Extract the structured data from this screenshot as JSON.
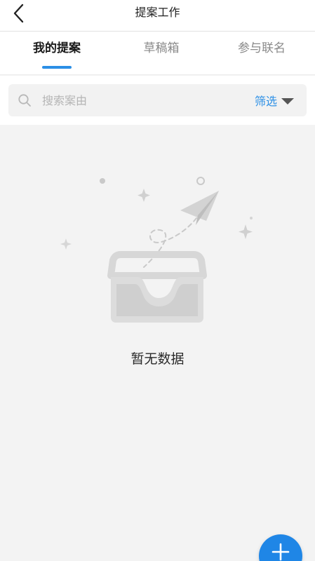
{
  "header": {
    "title": "提案工作"
  },
  "tabs": [
    {
      "label": "我的提案",
      "active": true
    },
    {
      "label": "草稿箱",
      "active": false
    },
    {
      "label": "参与联名",
      "active": false
    }
  ],
  "search": {
    "placeholder": "搜索案由",
    "value": "",
    "filter_label": "筛选"
  },
  "empty_state": {
    "message": "暂无数据"
  },
  "colors": {
    "accent": "#2b8fe6",
    "fab": "#1f86e6",
    "background": "#f3f3f3"
  },
  "icons": {
    "back": "chevron-left-icon",
    "search": "search-icon",
    "filter": "caret-down-icon",
    "fab": "plus-icon",
    "empty": "empty-inbox-illustration"
  }
}
